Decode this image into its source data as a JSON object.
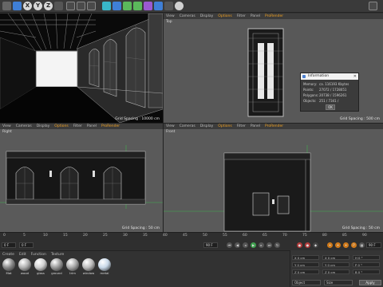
{
  "toolbar": {
    "axis_buttons": [
      "X",
      "Y",
      "Z"
    ],
    "colors": {
      "background": "#3a3a3a",
      "accent": "#f0a020",
      "blue": "#3f7fd6",
      "cyan": "#39b6c8",
      "green": "#5bb85b"
    }
  },
  "viewports": {
    "perspective": {
      "menu": [
        "View",
        "Cameras",
        "Display",
        "Options",
        "Filter",
        "Panel",
        "ProRender"
      ],
      "grid_spacing": "Grid Spacing : 10000 cm"
    },
    "top": {
      "menu": [
        "View",
        "Cameras",
        "Display",
        "Options",
        "Filter",
        "Panel",
        "ProRender"
      ],
      "name": "Top",
      "grid_spacing": "Grid Spacing : 500 cm"
    },
    "right": {
      "menu": [
        "View",
        "Cameras",
        "Display",
        "Options",
        "Filter",
        "Panel",
        "ProRender"
      ],
      "name": "Right",
      "grid_spacing": "Grid Spacing : 50 cm"
    },
    "front": {
      "menu": [
        "View",
        "Cameras",
        "Display",
        "Options",
        "Filter",
        "Panel",
        "ProRender"
      ],
      "name": "Front",
      "grid_spacing": "Grid Spacing : 50 cm"
    }
  },
  "info_dialog": {
    "title": "Information",
    "rows": [
      {
        "label": "Memory:",
        "value": "ca. 116193 Kbytes"
      },
      {
        "label": "Points:",
        "value": "27072 / 1728051"
      },
      {
        "label": "Polygons:",
        "value": "20738 / 1596261"
      },
      {
        "label": "Objects:",
        "value": "251 / 7341 /"
      }
    ],
    "ok_label": "OK"
  },
  "timeline": {
    "ticks": [
      "0",
      "5",
      "10",
      "15",
      "20",
      "25",
      "30",
      "35",
      "40",
      "45",
      "50",
      "55",
      "60",
      "65",
      "70",
      "75",
      "80",
      "85",
      "90"
    ],
    "end_frame": "0 F"
  },
  "transport": {
    "current_frame": "0 F",
    "start_frame": "0 F",
    "end_frame": "90 F",
    "max_frame": "90 F"
  },
  "material_manager": {
    "menu": [
      "Create",
      "Edit",
      "Function",
      "Texture"
    ],
    "materials": [
      {
        "name": "Mat",
        "color": "#8a8a8a"
      },
      {
        "name": "wood",
        "color": "#b0b0b0"
      },
      {
        "name": "glass",
        "color": "#d0d0d0"
      },
      {
        "name": "ground",
        "color": "#9a9a9a"
      },
      {
        "name": "trim",
        "color": "#a8a8a8"
      },
      {
        "name": "window",
        "color": "#bcbcbc"
      },
      {
        "name": "metal",
        "color": "#c8d8e8"
      }
    ]
  },
  "attributes": {
    "rows": [
      [
        "X  0 cm",
        "X  0 cm",
        "H  0 °"
      ],
      [
        "Y  0 cm",
        "Y  0 cm",
        "P  0 °"
      ],
      [
        "Z  0 cm",
        "Z  0 cm",
        "B  0 °"
      ]
    ],
    "coord_select": "Object",
    "size_select": "Size",
    "apply_label": "Apply"
  }
}
